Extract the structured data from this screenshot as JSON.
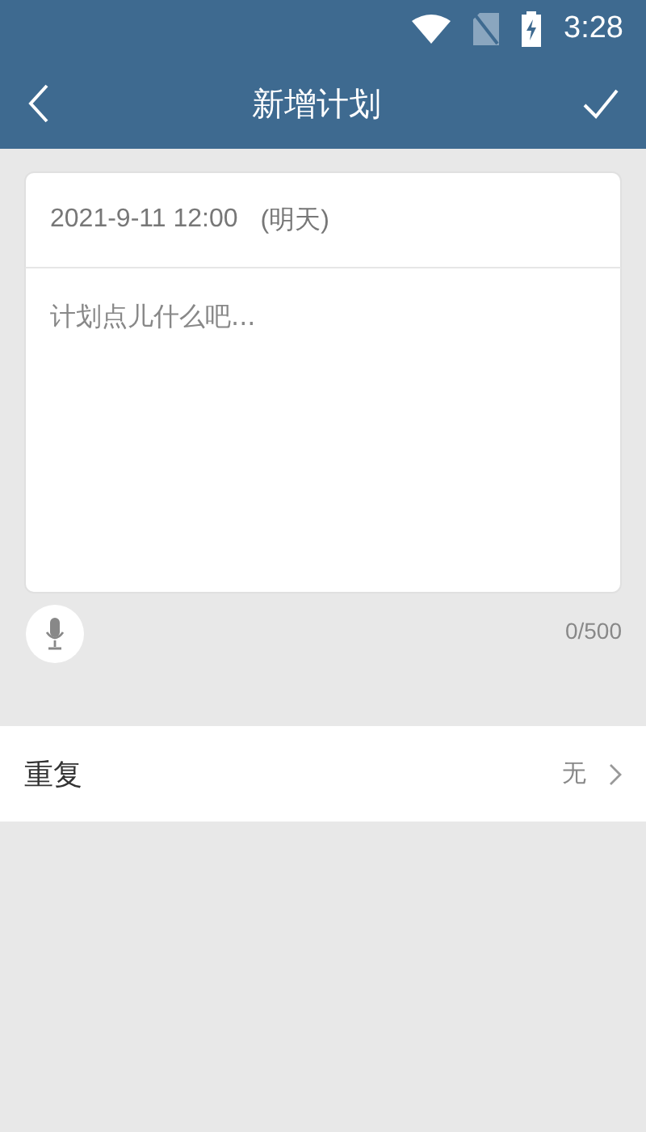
{
  "status_bar": {
    "time": "3:28"
  },
  "app_bar": {
    "title": "新增计划"
  },
  "plan": {
    "date": "2021-9-11 12:00",
    "day_hint": "(明天)",
    "placeholder": "计划点儿什么吧...",
    "counter": "0/500"
  },
  "repeat": {
    "label": "重复",
    "value": "无"
  }
}
